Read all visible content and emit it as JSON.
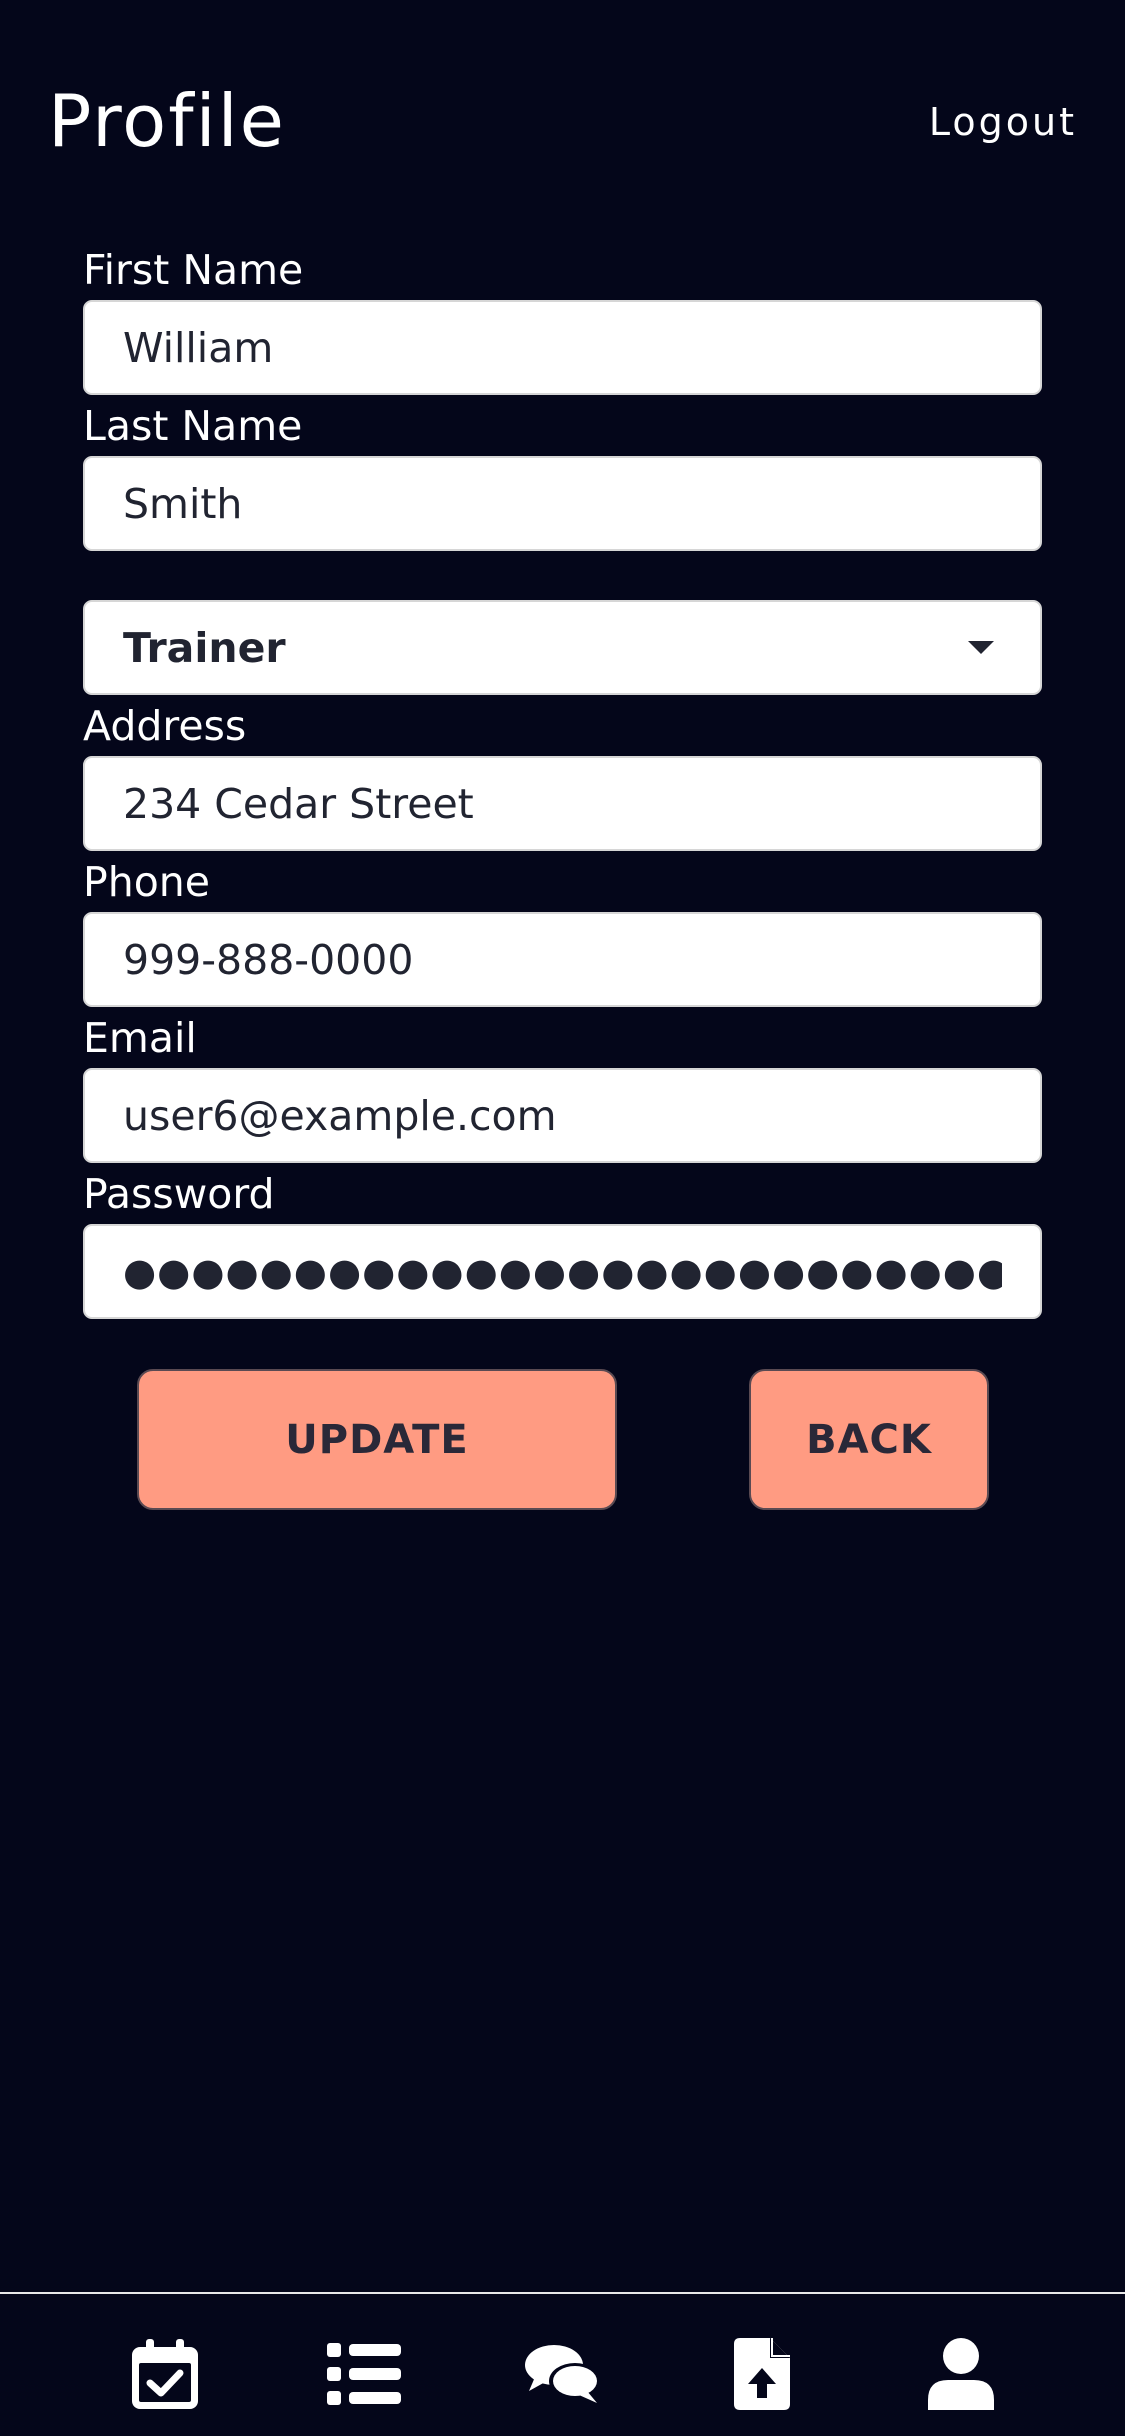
{
  "header": {
    "title": "Profile",
    "logout_label": "Logout"
  },
  "form": {
    "first_name": {
      "label": "First Name",
      "value": "William"
    },
    "last_name": {
      "label": "Last Name",
      "value": "Smith"
    },
    "role": {
      "selected": "Trainer"
    },
    "address": {
      "label": "Address",
      "value": "234 Cedar Street"
    },
    "phone": {
      "label": "Phone",
      "value": "999-888-0000"
    },
    "email": {
      "label": "Email",
      "value": "user6@example.com"
    },
    "password": {
      "label": "Password",
      "value": "●●●●●●●●●●●●●●●●●●●●●●●●●●●●●●●●●●●●●●●●●●●●"
    }
  },
  "actions": {
    "update_label": "UPDATE",
    "back_label": "BACK"
  },
  "tabbar": {
    "items": [
      {
        "icon": "calendar-check-icon"
      },
      {
        "icon": "list-icon"
      },
      {
        "icon": "comments-icon"
      },
      {
        "icon": "file-upload-icon"
      },
      {
        "icon": "user-icon"
      }
    ]
  },
  "colors": {
    "background": "#04061a",
    "accent": "#ff9b82",
    "input_text": "#212431"
  }
}
